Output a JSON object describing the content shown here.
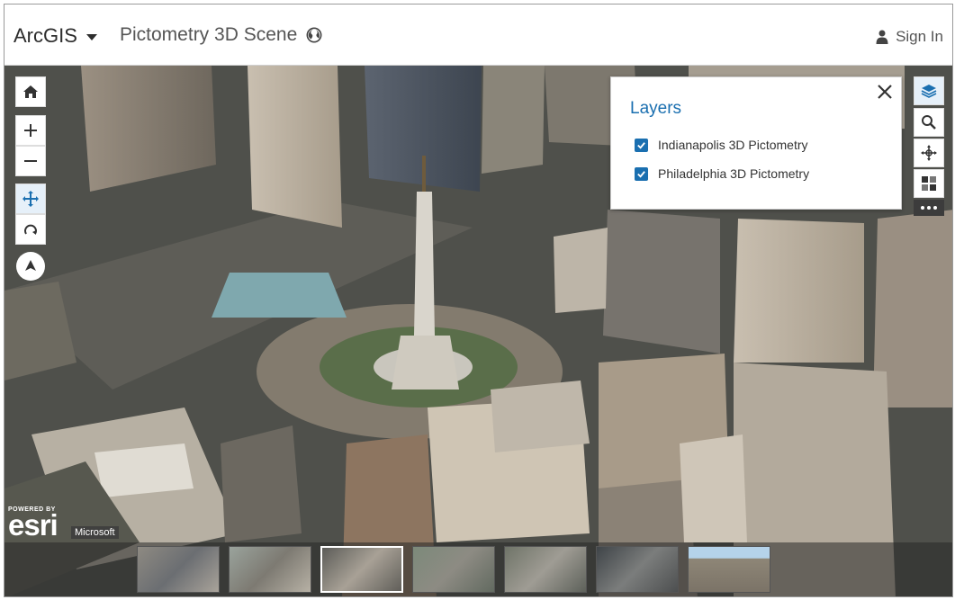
{
  "header": {
    "brand_label": "ArcGIS",
    "scene_title": "Pictometry 3D Scene",
    "signin_label": "Sign In"
  },
  "layers_panel": {
    "title": "Layers",
    "items": [
      {
        "label": "Indianapolis 3D Pictometry",
        "checked": true
      },
      {
        "label": "Philadelphia 3D Pictometry",
        "checked": true
      }
    ]
  },
  "attribution": {
    "powered_by": "POWERED BY",
    "esri": "esri",
    "provider": "Microsoft"
  },
  "slides": {
    "count": 7,
    "selected_index": 2
  },
  "icons": {
    "header": [
      "chevron-down-icon",
      "globe-icon",
      "user-icon"
    ],
    "left_tools": [
      "home-icon",
      "zoom-in-icon",
      "zoom-out-icon",
      "pan-icon",
      "rotate-icon",
      "compass-icon"
    ],
    "right_tools": [
      "layers-icon",
      "search-icon",
      "move-icon",
      "basemap-gallery-icon",
      "more-icon"
    ]
  },
  "colors": {
    "accent": "#1a6fb0",
    "panel_bg": "#ffffff",
    "active_tool_bg": "#e6f0f9"
  }
}
